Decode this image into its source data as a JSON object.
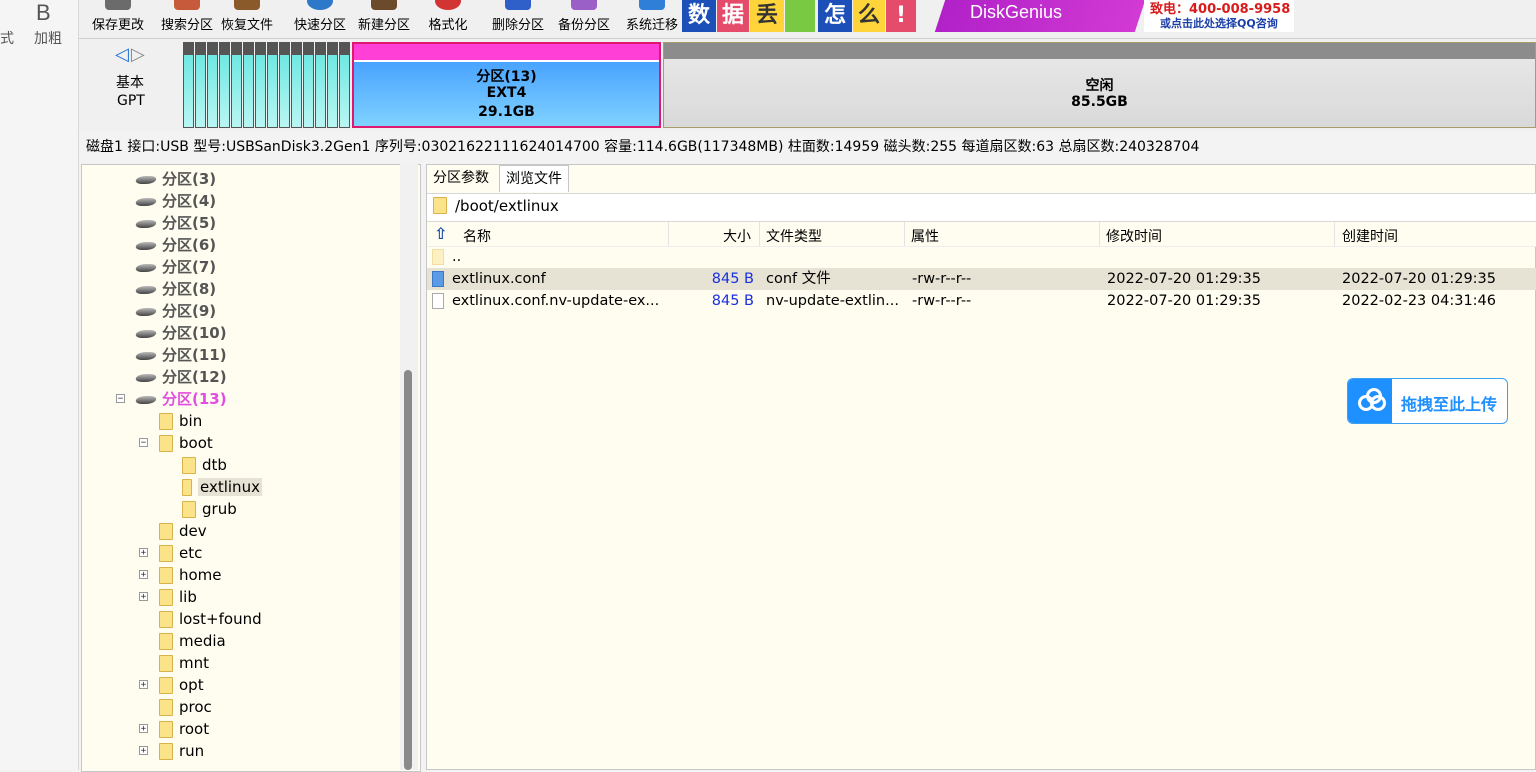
{
  "left_strip": {
    "label_left": "式",
    "label_right": "加粗",
    "icon_letter": "B"
  },
  "toolbar": {
    "buttons": [
      "保存更改",
      "搜索分区",
      "恢复文件",
      "快速分区",
      "新建分区",
      "格式化",
      "删除分区",
      "备份分区",
      "系统迁移"
    ]
  },
  "banner": {
    "chars": [
      "数",
      "据",
      "丢",
      "怎",
      "么",
      "!"
    ],
    "brand": "DiskGenius",
    "phone": "致电：400-008-9958",
    "qq": "或点击此处选择QQ咨询"
  },
  "disk_map": {
    "type_line1": "基本",
    "type_line2": "GPT",
    "stripe_count": 14,
    "selected_partition": {
      "name": "分区(13)",
      "fs": "EXT4",
      "size": "29.1GB"
    },
    "free_space": {
      "name": "空闲",
      "size": "85.5GB"
    }
  },
  "disk_info": "磁盘1 接口:USB  型号:USBSanDisk3.2Gen1  序列号:03021622111624014700  容量:114.6GB(117348MB)  柱面数:14959  磁头数:255  每道扇区数:63  总扇区数:240328704",
  "tree": {
    "partitions": [
      "分区(3)",
      "分区(4)",
      "分区(5)",
      "分区(6)",
      "分区(7)",
      "分区(8)",
      "分区(9)",
      "分区(10)",
      "分区(11)",
      "分区(12)"
    ],
    "selected_partition": "分区(13)",
    "root_folders": [
      "bin",
      "boot",
      "dev",
      "etc",
      "home",
      "lib",
      "lost+found",
      "media",
      "mnt",
      "opt",
      "proc",
      "root",
      "run"
    ],
    "boot_children": [
      "dtb",
      "extlinux",
      "grub"
    ]
  },
  "tabs": [
    "分区参数",
    "浏览文件"
  ],
  "path": "/boot/extlinux",
  "columns": [
    "名称",
    "大小",
    "文件类型",
    "属性",
    "修改时间",
    "创建时间"
  ],
  "files": [
    {
      "name": "..",
      "size": "",
      "type": "",
      "attr": "",
      "modified": "",
      "created": ""
    },
    {
      "name": "extlinux.conf",
      "size": "845 B",
      "type": "conf 文件",
      "attr": "-rw-r--r--",
      "modified": "2022-07-20 01:29:35",
      "created": "2022-07-20 01:29:35"
    },
    {
      "name": "extlinux.conf.nv-update-ex...",
      "size": "845 B",
      "type": "nv-update-extlin...",
      "attr": "-rw-r--r--",
      "modified": "2022-07-20 01:29:35",
      "created": "2022-02-23 04:31:46"
    }
  ],
  "upload": {
    "label": "拖拽至此上传"
  },
  "colors": {
    "partition_border": "#e0176f",
    "selected_text": "#e34ce0",
    "size_text": "#1a2fe0",
    "upload_blue": "#1e90ff"
  }
}
